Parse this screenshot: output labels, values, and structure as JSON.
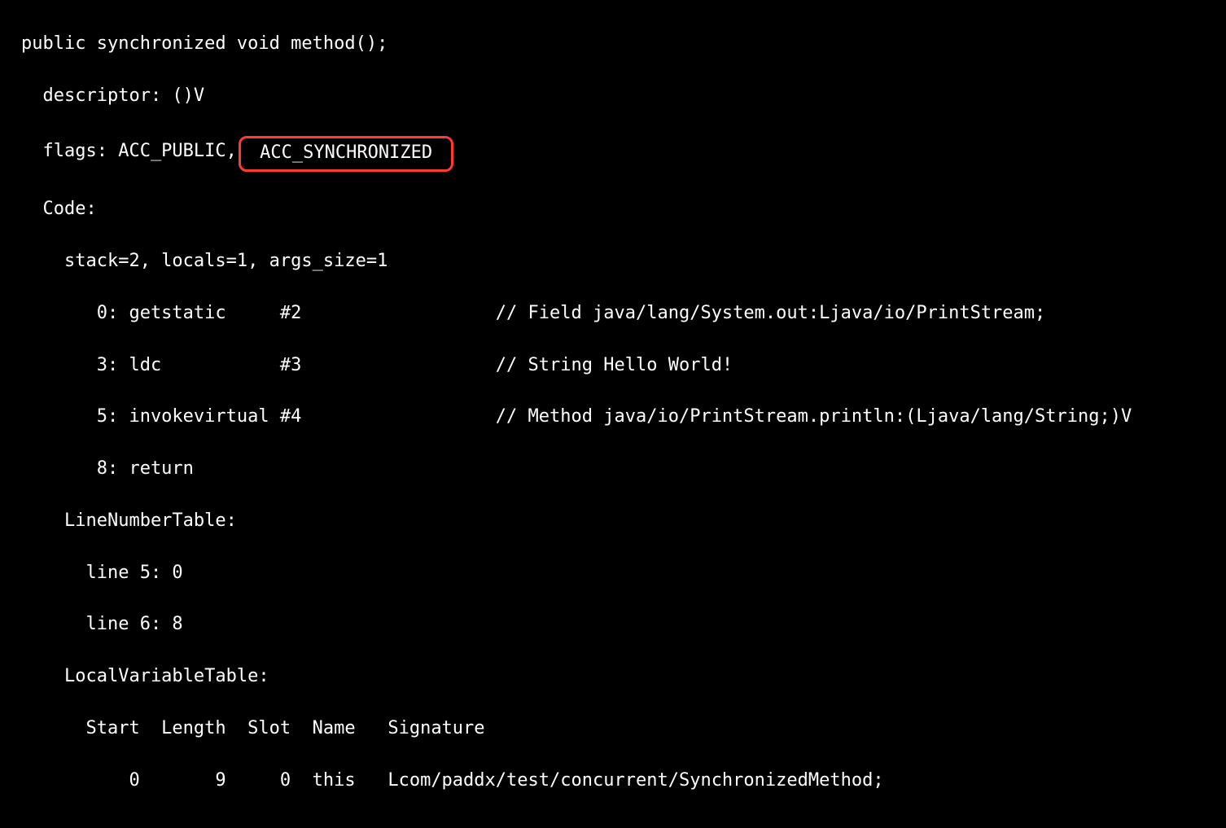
{
  "line1": "public synchronized void method();",
  "line2": "  descriptor: ()V",
  "line3_prefix": "  flags: ACC_PUBLIC,",
  "line3_highlight": " ACC_SYNCHRONIZED ",
  "line4": "  Code:",
  "line5": "    stack=2, locals=1, args_size=1",
  "line6": "       0: getstatic     #2                  // Field java/lang/System.out:Ljava/io/PrintStream;",
  "line7": "       3: ldc           #3                  // String Hello World!",
  "line8": "       5: invokevirtual #4                  // Method java/io/PrintStream.println:(Ljava/lang/String;)V",
  "line9": "       8: return",
  "line10": "    LineNumberTable:",
  "line11": "      line 5: 0",
  "line12": "      line 6: 8",
  "line13": "    LocalVariableTable:",
  "line14": "      Start  Length  Slot  Name   Signature",
  "line15": "          0       9     0  this   Lcom/paddx/test/concurrent/SynchronizedMethod;"
}
